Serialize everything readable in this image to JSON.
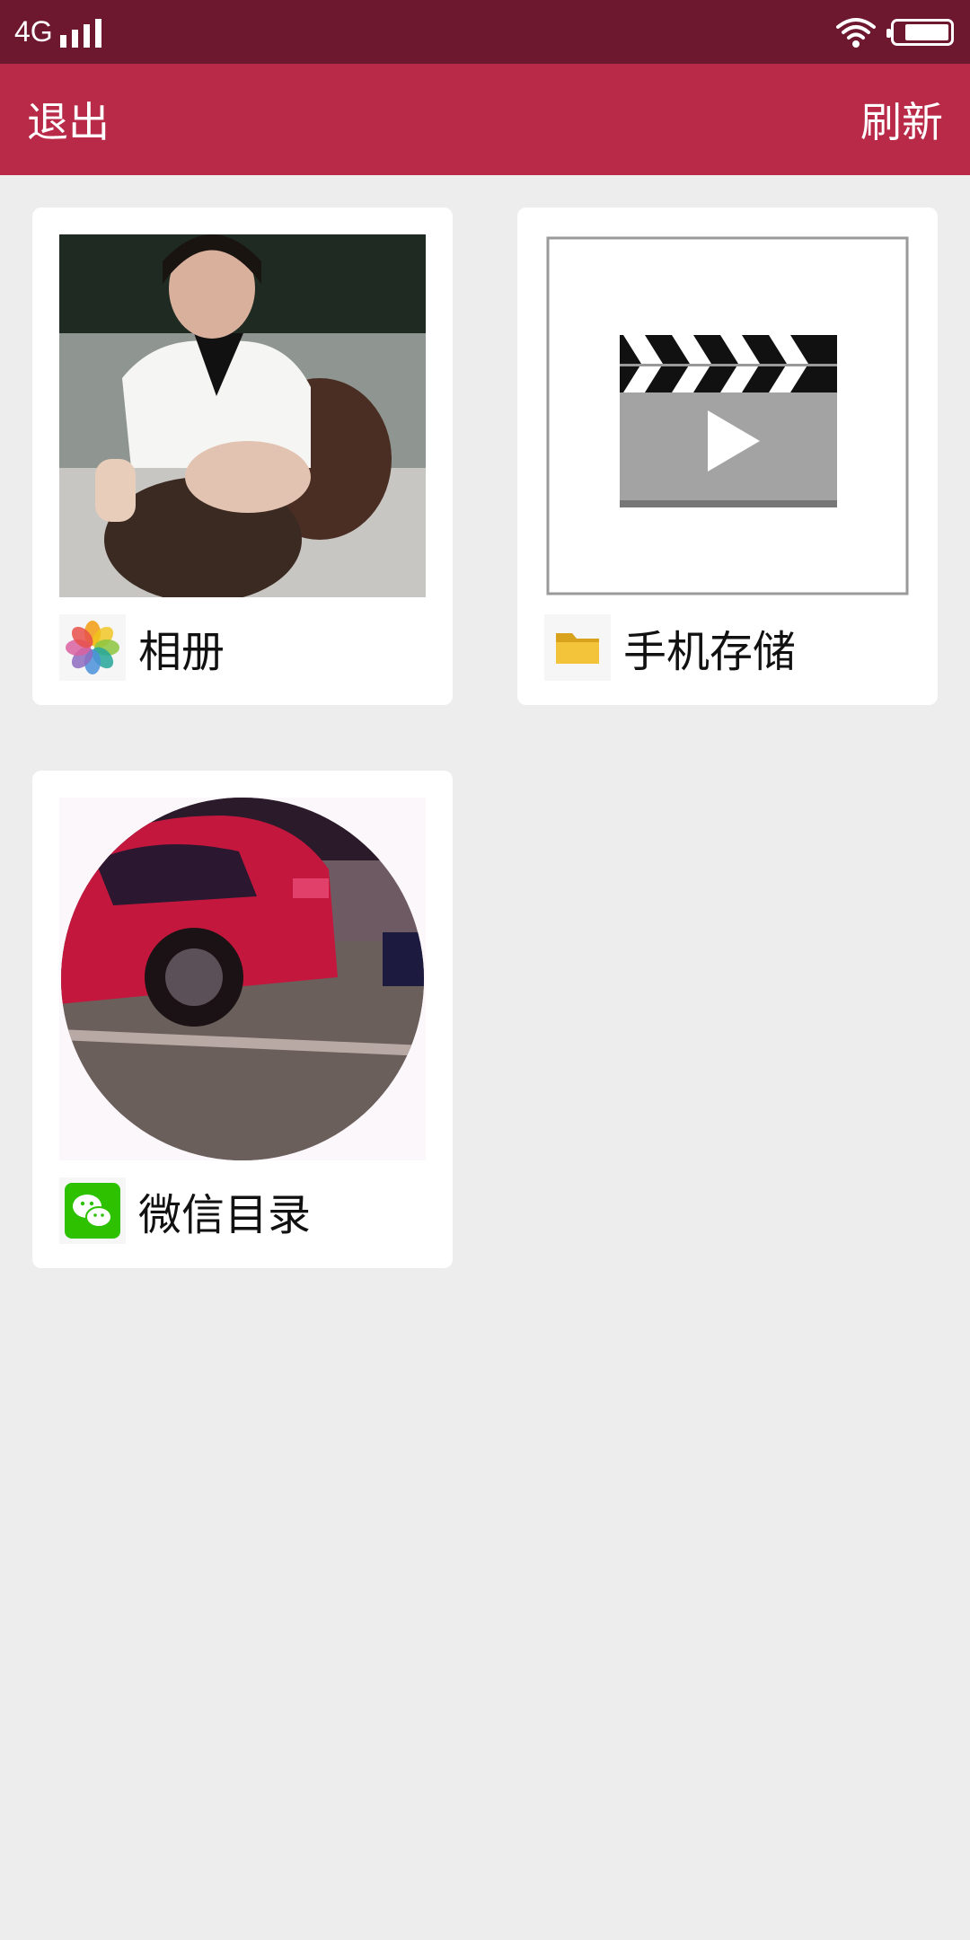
{
  "status_bar": {
    "network": "4G",
    "signal_level": 4,
    "battery_level": 0.75,
    "icons": [
      "signal-icon",
      "wifi-icon",
      "battery-icon"
    ]
  },
  "app_bar": {
    "left_action": "退出",
    "right_action": "刷新",
    "color": "#b82a48"
  },
  "cards": [
    {
      "label": "相册",
      "icon": "photos-flower-icon",
      "thumbnail": "person-photo"
    },
    {
      "label": "手机存储",
      "icon": "folder-icon",
      "thumbnail": "video-clapperboard"
    },
    {
      "label": "微信目录",
      "icon": "wechat-icon",
      "thumbnail": "red-car-photo"
    }
  ],
  "colors": {
    "status_bar": "#6e1830",
    "background": "#ededed",
    "card": "#ffffff"
  }
}
